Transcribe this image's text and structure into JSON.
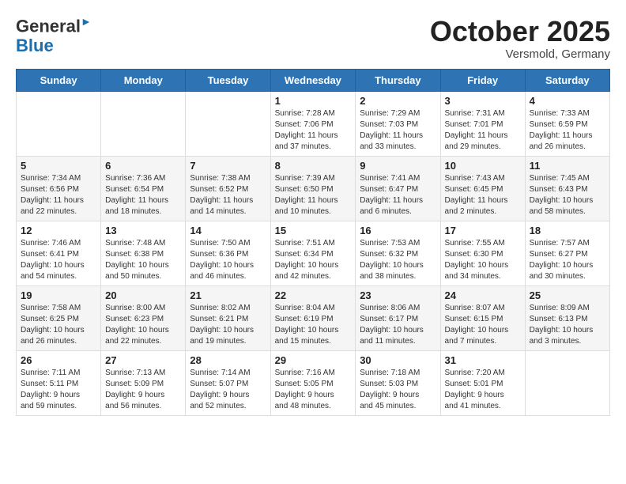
{
  "logo": {
    "general": "General",
    "blue": "Blue"
  },
  "header": {
    "month": "October 2025",
    "location": "Versmold, Germany"
  },
  "weekdays": [
    "Sunday",
    "Monday",
    "Tuesday",
    "Wednesday",
    "Thursday",
    "Friday",
    "Saturday"
  ],
  "weeks": [
    [
      {
        "day": "",
        "info": ""
      },
      {
        "day": "",
        "info": ""
      },
      {
        "day": "",
        "info": ""
      },
      {
        "day": "1",
        "info": "Sunrise: 7:28 AM\nSunset: 7:06 PM\nDaylight: 11 hours\nand 37 minutes."
      },
      {
        "day": "2",
        "info": "Sunrise: 7:29 AM\nSunset: 7:03 PM\nDaylight: 11 hours\nand 33 minutes."
      },
      {
        "day": "3",
        "info": "Sunrise: 7:31 AM\nSunset: 7:01 PM\nDaylight: 11 hours\nand 29 minutes."
      },
      {
        "day": "4",
        "info": "Sunrise: 7:33 AM\nSunset: 6:59 PM\nDaylight: 11 hours\nand 26 minutes."
      }
    ],
    [
      {
        "day": "5",
        "info": "Sunrise: 7:34 AM\nSunset: 6:56 PM\nDaylight: 11 hours\nand 22 minutes."
      },
      {
        "day": "6",
        "info": "Sunrise: 7:36 AM\nSunset: 6:54 PM\nDaylight: 11 hours\nand 18 minutes."
      },
      {
        "day": "7",
        "info": "Sunrise: 7:38 AM\nSunset: 6:52 PM\nDaylight: 11 hours\nand 14 minutes."
      },
      {
        "day": "8",
        "info": "Sunrise: 7:39 AM\nSunset: 6:50 PM\nDaylight: 11 hours\nand 10 minutes."
      },
      {
        "day": "9",
        "info": "Sunrise: 7:41 AM\nSunset: 6:47 PM\nDaylight: 11 hours\nand 6 minutes."
      },
      {
        "day": "10",
        "info": "Sunrise: 7:43 AM\nSunset: 6:45 PM\nDaylight: 11 hours\nand 2 minutes."
      },
      {
        "day": "11",
        "info": "Sunrise: 7:45 AM\nSunset: 6:43 PM\nDaylight: 10 hours\nand 58 minutes."
      }
    ],
    [
      {
        "day": "12",
        "info": "Sunrise: 7:46 AM\nSunset: 6:41 PM\nDaylight: 10 hours\nand 54 minutes."
      },
      {
        "day": "13",
        "info": "Sunrise: 7:48 AM\nSunset: 6:38 PM\nDaylight: 10 hours\nand 50 minutes."
      },
      {
        "day": "14",
        "info": "Sunrise: 7:50 AM\nSunset: 6:36 PM\nDaylight: 10 hours\nand 46 minutes."
      },
      {
        "day": "15",
        "info": "Sunrise: 7:51 AM\nSunset: 6:34 PM\nDaylight: 10 hours\nand 42 minutes."
      },
      {
        "day": "16",
        "info": "Sunrise: 7:53 AM\nSunset: 6:32 PM\nDaylight: 10 hours\nand 38 minutes."
      },
      {
        "day": "17",
        "info": "Sunrise: 7:55 AM\nSunset: 6:30 PM\nDaylight: 10 hours\nand 34 minutes."
      },
      {
        "day": "18",
        "info": "Sunrise: 7:57 AM\nSunset: 6:27 PM\nDaylight: 10 hours\nand 30 minutes."
      }
    ],
    [
      {
        "day": "19",
        "info": "Sunrise: 7:58 AM\nSunset: 6:25 PM\nDaylight: 10 hours\nand 26 minutes."
      },
      {
        "day": "20",
        "info": "Sunrise: 8:00 AM\nSunset: 6:23 PM\nDaylight: 10 hours\nand 22 minutes."
      },
      {
        "day": "21",
        "info": "Sunrise: 8:02 AM\nSunset: 6:21 PM\nDaylight: 10 hours\nand 19 minutes."
      },
      {
        "day": "22",
        "info": "Sunrise: 8:04 AM\nSunset: 6:19 PM\nDaylight: 10 hours\nand 15 minutes."
      },
      {
        "day": "23",
        "info": "Sunrise: 8:06 AM\nSunset: 6:17 PM\nDaylight: 10 hours\nand 11 minutes."
      },
      {
        "day": "24",
        "info": "Sunrise: 8:07 AM\nSunset: 6:15 PM\nDaylight: 10 hours\nand 7 minutes."
      },
      {
        "day": "25",
        "info": "Sunrise: 8:09 AM\nSunset: 6:13 PM\nDaylight: 10 hours\nand 3 minutes."
      }
    ],
    [
      {
        "day": "26",
        "info": "Sunrise: 7:11 AM\nSunset: 5:11 PM\nDaylight: 9 hours\nand 59 minutes."
      },
      {
        "day": "27",
        "info": "Sunrise: 7:13 AM\nSunset: 5:09 PM\nDaylight: 9 hours\nand 56 minutes."
      },
      {
        "day": "28",
        "info": "Sunrise: 7:14 AM\nSunset: 5:07 PM\nDaylight: 9 hours\nand 52 minutes."
      },
      {
        "day": "29",
        "info": "Sunrise: 7:16 AM\nSunset: 5:05 PM\nDaylight: 9 hours\nand 48 minutes."
      },
      {
        "day": "30",
        "info": "Sunrise: 7:18 AM\nSunset: 5:03 PM\nDaylight: 9 hours\nand 45 minutes."
      },
      {
        "day": "31",
        "info": "Sunrise: 7:20 AM\nSunset: 5:01 PM\nDaylight: 9 hours\nand 41 minutes."
      },
      {
        "day": "",
        "info": ""
      }
    ]
  ]
}
